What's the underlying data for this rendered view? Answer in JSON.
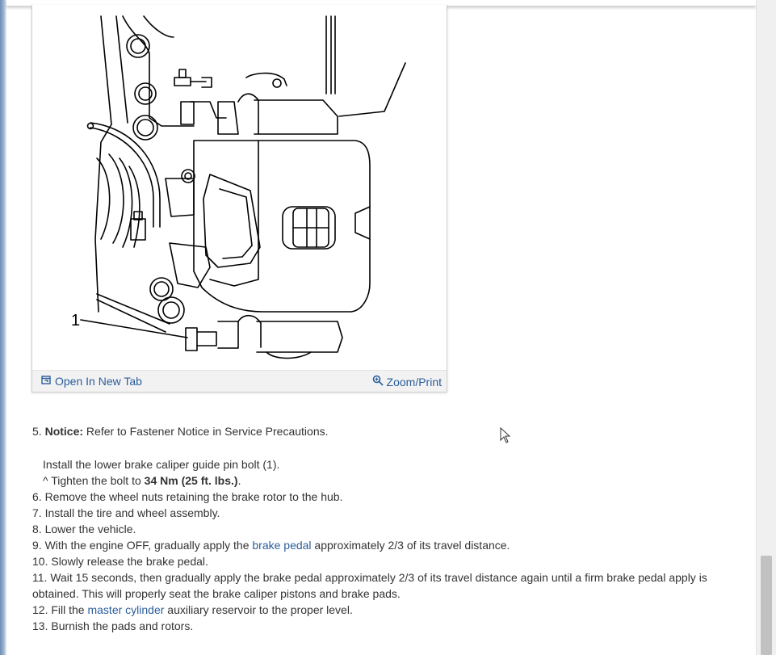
{
  "figure": {
    "callout": "1",
    "open_tab_label": "Open In New Tab",
    "zoom_label": "Zoom/Print",
    "icons": [
      "open-new-tab-icon",
      "magnifier-icon"
    ]
  },
  "steps": {
    "s5_num": "5.",
    "s5_notice": "Notice:",
    "s5_text": " Refer to Fastener Notice in Service Precautions.",
    "s5_install": "Install the lower brake caliper guide pin bolt (1).",
    "s5_tighten_pre": "^  Tighten the bolt to ",
    "s5_torque": "34 Nm (25 ft. lbs.)",
    "s5_tighten_post": ".",
    "s6": "6. Remove the wheel nuts retaining the brake rotor to the hub.",
    "s7": "7. Install the tire and wheel assembly.",
    "s8": "8. Lower the vehicle.",
    "s9_pre": "9. With the engine OFF, gradually apply the ",
    "s9_link": "brake pedal",
    "s9_post": " approximately 2/3 of its travel distance.",
    "s10": "10. Slowly release the brake pedal.",
    "s11": "11. Wait 15 seconds, then gradually apply the brake pedal approximately 2/3 of its travel distance again until a firm brake pedal apply is obtained. This will properly seat the brake caliper pistons and brake pads.",
    "s12_pre": "12. Fill the ",
    "s12_link": "master cylinder",
    "s12_post": " auxiliary reservoir to the proper level.",
    "s13": "13. Burnish the pads and rotors."
  },
  "colors": {
    "link": "#2a5d9a",
    "text": "#333333",
    "toolbar_bg": "#f2f2f2"
  }
}
